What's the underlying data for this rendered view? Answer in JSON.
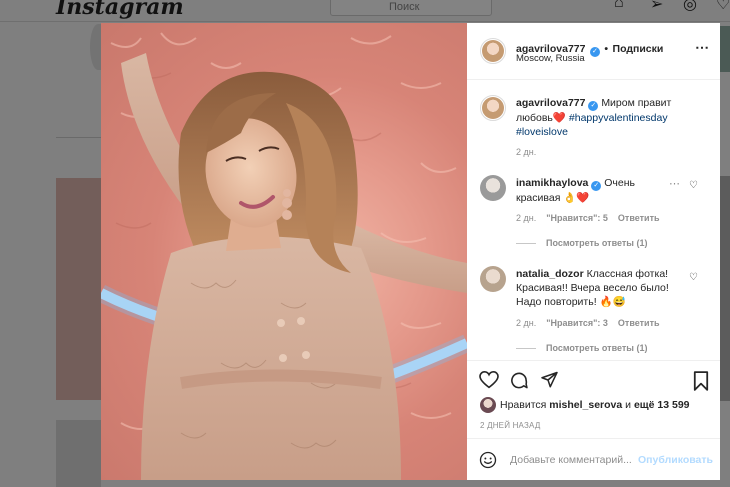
{
  "background": {
    "logo": "Instagram",
    "search_placeholder": "Поиск"
  },
  "post": {
    "author": {
      "username": "agavrilova777",
      "follow_label": "Подписки",
      "location": "Moscow, Russia"
    },
    "caption": {
      "username": "agavrilova777",
      "text": "Миром правит любовь",
      "emoji": "❤️",
      "hashtags": [
        "#happyvalentinesday",
        "#loveislove"
      ],
      "time": "2 дн."
    },
    "comments": [
      {
        "username": "inamikhaylova",
        "text": "Очень красивая",
        "emoji": "👌❤️",
        "time": "2 дн.",
        "likes": "\"Нравится\": 5",
        "reply_label": "Ответить",
        "view_replies": "Посмотреть ответы (1)"
      },
      {
        "username": "natalia_dozor",
        "text": "Классная фотка! Красивая!! Вчера весело было! Надо повторить!",
        "emoji": "🔥😅",
        "time": "2 дн.",
        "likes": "\"Нравится\": 3",
        "reply_label": "Ответить",
        "view_replies": "Посмотреть ответы (1)"
      }
    ],
    "likes": {
      "prefix": "Нравится",
      "user": "mishel_serova",
      "middle": "и",
      "rest": "ещё 13 599"
    },
    "date": "2 ДНЕЙ НАЗАД",
    "add_comment_placeholder": "Добавьте комментарий...",
    "publish_label": "Опубликовать"
  },
  "colors": {
    "verified": "#3897f0",
    "heart": "#ed4956",
    "publish_disabled": "#b3dbff",
    "hashtag": "#00376b"
  }
}
